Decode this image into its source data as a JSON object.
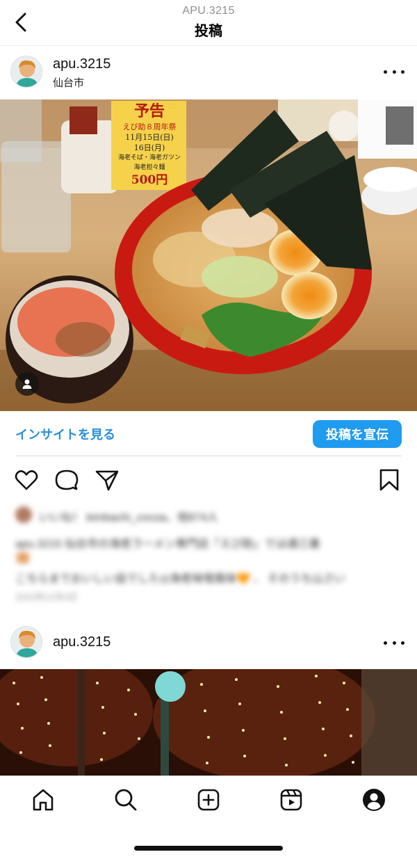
{
  "header": {
    "account_handle": "APU.3215",
    "title": "投稿"
  },
  "post1": {
    "username": "apu.3215",
    "location": "仙台市",
    "photo_sign": {
      "heading": "予告",
      "line1": "えび助８周年祭",
      "line2": "11月15日(日)",
      "line3": "16日(月)",
      "line4": "海老そば・海老ガツン",
      "line5": "海老担々麺",
      "price": "500円"
    },
    "insights_label": "インサイトを見る",
    "promote_label": "投稿を宣伝",
    "caption_blurred": {
      "likes": "いいね！ kimbachi_cocoa、他874人",
      "caption": "apu.3215 仙台市の海老ラーメン専門店「えび助」では通三番",
      "caption2": "こちらまでおいしい皿でした◎海老味噌風味🧡 、 そのうち山さい",
      "date": "2022年12月4日"
    }
  },
  "post2": {
    "username": "apu.3215"
  },
  "icons": {
    "back": "chevron-left-icon",
    "more": "more-horizontal-icon",
    "like": "heart-icon",
    "comment": "comment-icon",
    "share": "send-icon",
    "save": "bookmark-icon",
    "tag": "person-tag-icon",
    "home": "home-icon",
    "search": "search-icon",
    "create": "plus-square-icon",
    "reels": "reels-icon",
    "profile": "profile-icon"
  },
  "colors": {
    "link_blue": "#2c8fd8",
    "button_blue": "#1f9bf0",
    "bowl_red": "#c91a12"
  }
}
